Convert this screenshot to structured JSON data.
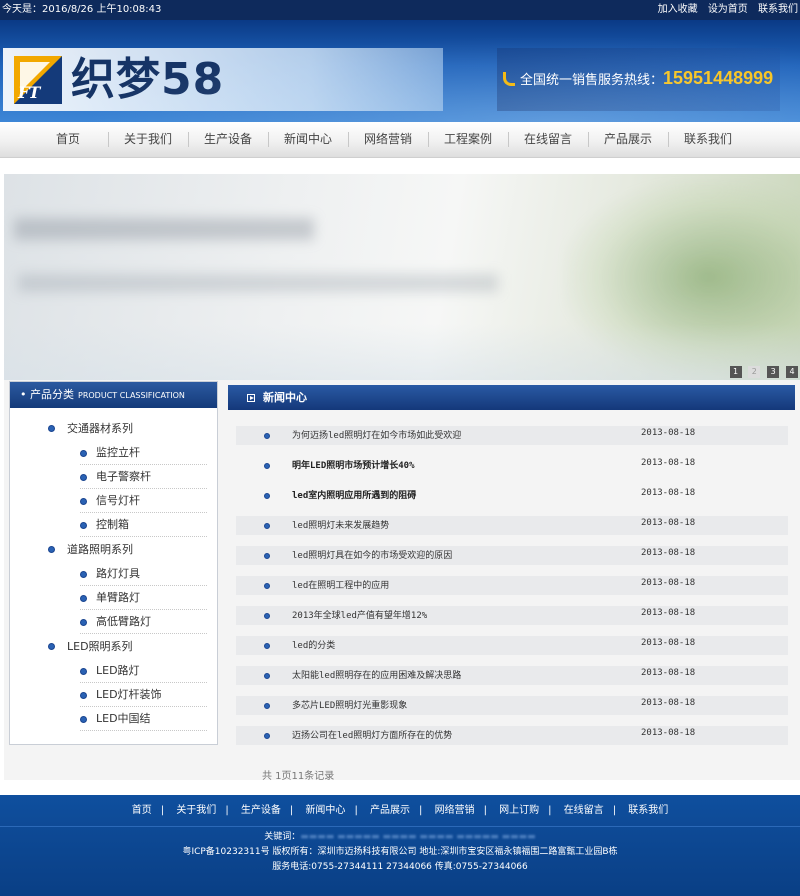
{
  "topbar": {
    "date": "今天是：2016/8/26 上午10:08:43",
    "links": [
      "加入收藏",
      "设为首页",
      "联系我们"
    ]
  },
  "header": {
    "logo_mark": "FT",
    "logo_text": "织梦58",
    "hotline_label": "全国统一销售服务热线：",
    "hotline_number": "15951448999"
  },
  "nav": [
    "首页",
    "关于我们",
    "生产设备",
    "新闻中心",
    "网络营销",
    "工程案例",
    "在线留言",
    "产品展示",
    "联系我们"
  ],
  "banner": {
    "dots": [
      "1",
      "2",
      "3",
      "4"
    ],
    "active_dot": 1
  },
  "sidebar": {
    "title": "产品分类",
    "title_en": "PRODUCT CLASSIFICATION",
    "categories": [
      {
        "label": "交通器材系列",
        "items": [
          "监控立杆",
          "电子警察杆",
          "信号灯杆",
          "控制箱"
        ]
      },
      {
        "label": "道路照明系列",
        "items": [
          "路灯灯具",
          "单臂路灯",
          "高低臂路灯"
        ]
      },
      {
        "label": "LED照明系列",
        "items": [
          "LED路灯",
          "LED灯杆装饰",
          "LED中国结"
        ]
      }
    ]
  },
  "news": {
    "title": "新闻中心",
    "items": [
      {
        "title": "为何迈扬led照明灯在如今市场如此受欢迎",
        "date": "2013-08-18",
        "bold": false
      },
      {
        "title": "明年LED照明市场预计增长40%",
        "date": "2013-08-18",
        "bold": true
      },
      {
        "title": "led室内照明应用所遇到的阻碍",
        "date": "2013-08-18",
        "bold": true
      },
      {
        "title": "led照明灯未来发展趋势",
        "date": "2013-08-18",
        "bold": false
      },
      {
        "title": "led照明灯具在如今的市场受欢迎的原因",
        "date": "2013-08-18",
        "bold": false
      },
      {
        "title": "led在照明工程中的应用",
        "date": "2013-08-18",
        "bold": false
      },
      {
        "title": "2013年全球led产值有望年增12%",
        "date": "2013-08-18",
        "bold": false
      },
      {
        "title": "led的分类",
        "date": "2013-08-18",
        "bold": false
      },
      {
        "title": "太阳能led照明存在的应用困难及解决思路",
        "date": "2013-08-18",
        "bold": false
      },
      {
        "title": "多芯片LED照明灯光重影现象",
        "date": "2013-08-18",
        "bold": false
      },
      {
        "title": "迈扬公司在led照明灯方面所存在的优势",
        "date": "2013-08-18",
        "bold": false
      }
    ],
    "pager": "共 1页11条记录"
  },
  "footer": {
    "nav": [
      "首页",
      "关于我们",
      "生产设备",
      "新闻中心",
      "产品展示",
      "网络营销",
      "网上订购",
      "在线留言",
      "联系我们"
    ],
    "keywords_label": "关键词：",
    "copyright": "粤ICP备10232311号 版权所有：深圳市迈扬科技有限公司 地址:深圳市宝安区福永镇福围二路富甄工业园B栋",
    "contact": "服务电话:0755-27344111 27344066 传真:0755-27344066"
  }
}
